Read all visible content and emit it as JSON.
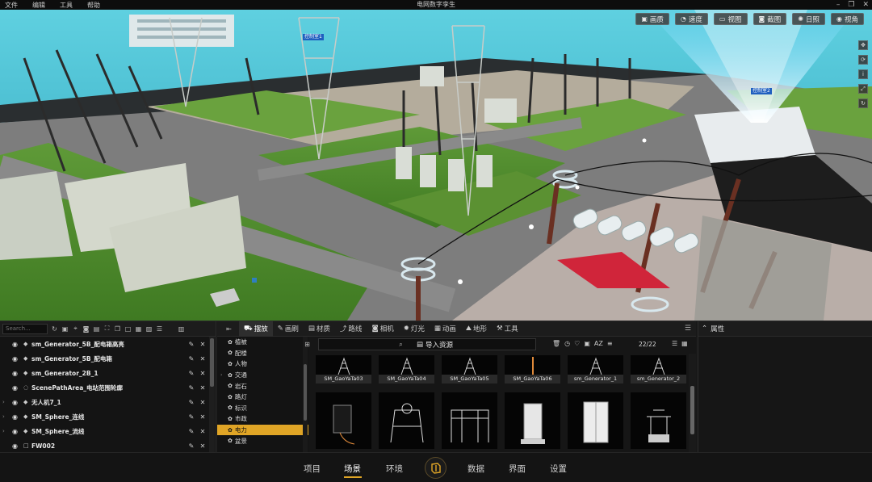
{
  "window": {
    "title": "电网数字孪生",
    "menu": [
      "文件",
      "编辑",
      "工具",
      "帮助"
    ]
  },
  "viewport": {
    "toolbar": [
      {
        "icon": "image-icon",
        "label": "画质"
      },
      {
        "icon": "speed-icon",
        "label": "速度"
      },
      {
        "icon": "view-icon",
        "label": "视图"
      },
      {
        "icon": "camera-icon",
        "label": "截图"
      },
      {
        "icon": "sun-icon",
        "label": "日照"
      },
      {
        "icon": "eye-icon",
        "label": "视角"
      }
    ],
    "scene_labels": [
      "控制室1",
      "控制室2"
    ]
  },
  "outliner": {
    "search_placeholder": "Search...",
    "rows": [
      {
        "label": "sm_Generator_5B_配电箱高亮",
        "expandable": false
      },
      {
        "label": "sm_Generator_5B_配电箱",
        "expandable": false
      },
      {
        "label": "sm_Generator_2B_1",
        "expandable": false
      },
      {
        "label": "ScenePathArea_电站范围轮廓",
        "expandable": false
      },
      {
        "label": "无人机7_1",
        "expandable": true
      },
      {
        "label": "SM_Sphere_连线",
        "expandable": true
      },
      {
        "label": "SM_Sphere_流线",
        "expandable": true
      },
      {
        "label": "FW002",
        "expandable": false
      }
    ]
  },
  "browser": {
    "tabs": [
      {
        "icon": "place-icon",
        "label": "摆放"
      },
      {
        "icon": "brush-icon",
        "label": "画刷"
      },
      {
        "icon": "material-icon",
        "label": "材质"
      },
      {
        "icon": "route-icon",
        "label": "路线"
      },
      {
        "icon": "camera-icon",
        "label": "相机"
      },
      {
        "icon": "light-icon",
        "label": "灯光"
      },
      {
        "icon": "animation-icon",
        "label": "动画"
      },
      {
        "icon": "terrain-icon",
        "label": "地形"
      },
      {
        "icon": "wrench-icon",
        "label": "工具"
      }
    ],
    "categories": [
      {
        "label": "植被",
        "expandable": false
      },
      {
        "label": "配楼",
        "expandable": false
      },
      {
        "label": "人物",
        "expandable": false
      },
      {
        "label": "交通",
        "expandable": true
      },
      {
        "label": "岩石",
        "expandable": false
      },
      {
        "label": "路灯",
        "expandable": false
      },
      {
        "label": "标识",
        "expandable": false
      },
      {
        "label": "市政",
        "expandable": false
      },
      {
        "label": "电力",
        "expandable": false,
        "selected": true
      },
      {
        "label": "盆景",
        "expandable": false
      }
    ],
    "import_label": "导入资源",
    "count": "22/22",
    "assets_row1": [
      "SM_GaoYaTa03",
      "SM_GaoYaTa04",
      "SM_GaoYaTa05",
      "SM_GaoYaTa06",
      "sm_Generator_1",
      "sm_Generator_2"
    ],
    "assets_row2": [
      "",
      "",
      "",
      "",
      "",
      ""
    ]
  },
  "properties": {
    "title": "属性"
  },
  "bottom_nav": {
    "items": [
      "项目",
      "场景",
      "环境",
      "数据",
      "界面",
      "设置"
    ],
    "active": "场景"
  },
  "colors": {
    "accent": "#e0a526",
    "label_blue": "#1f5fbf"
  }
}
